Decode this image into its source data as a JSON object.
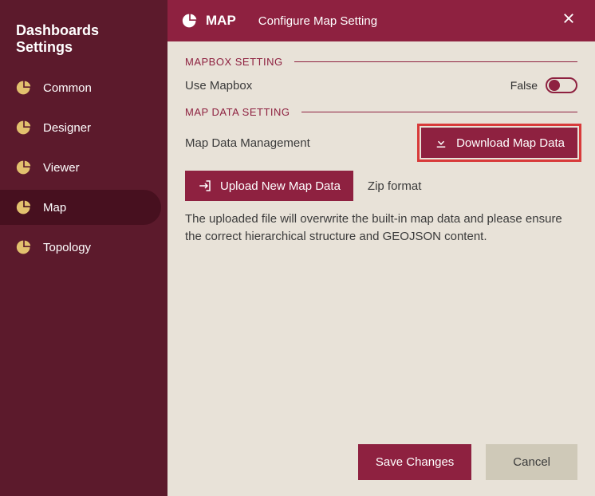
{
  "sidebar": {
    "title": "Dashboards Settings",
    "items": [
      {
        "id": "common",
        "label": "Common",
        "active": false
      },
      {
        "id": "designer",
        "label": "Designer",
        "active": false
      },
      {
        "id": "viewer",
        "label": "Viewer",
        "active": false
      },
      {
        "id": "map",
        "label": "Map",
        "active": true
      },
      {
        "id": "topology",
        "label": "Topology",
        "active": false
      }
    ]
  },
  "header": {
    "title": "MAP",
    "subtitle": "Configure Map Setting"
  },
  "sections": {
    "mapbox": {
      "heading": "MAPBOX SETTING",
      "use_mapbox_label": "Use Mapbox",
      "use_mapbox_value_text": "False",
      "use_mapbox_value": false
    },
    "mapdata": {
      "heading": "MAP DATA SETTING",
      "management_label": "Map Data Management",
      "download_label": "Download Map Data",
      "upload_label": "Upload New Map Data",
      "upload_hint": "Zip format",
      "description": "The uploaded file will overwrite the built-in map data and please ensure the correct hierarchical structure and GEOJSON content."
    }
  },
  "footer": {
    "save_label": "Save Changes",
    "cancel_label": "Cancel"
  },
  "colors": {
    "accent": "#8e2140",
    "sidebar_bg": "#5c1a2c",
    "sidebar_active": "#47101f",
    "icon_gold": "#e2c16e",
    "panel_bg": "#e8e2d8",
    "highlight": "#d83a3a"
  }
}
